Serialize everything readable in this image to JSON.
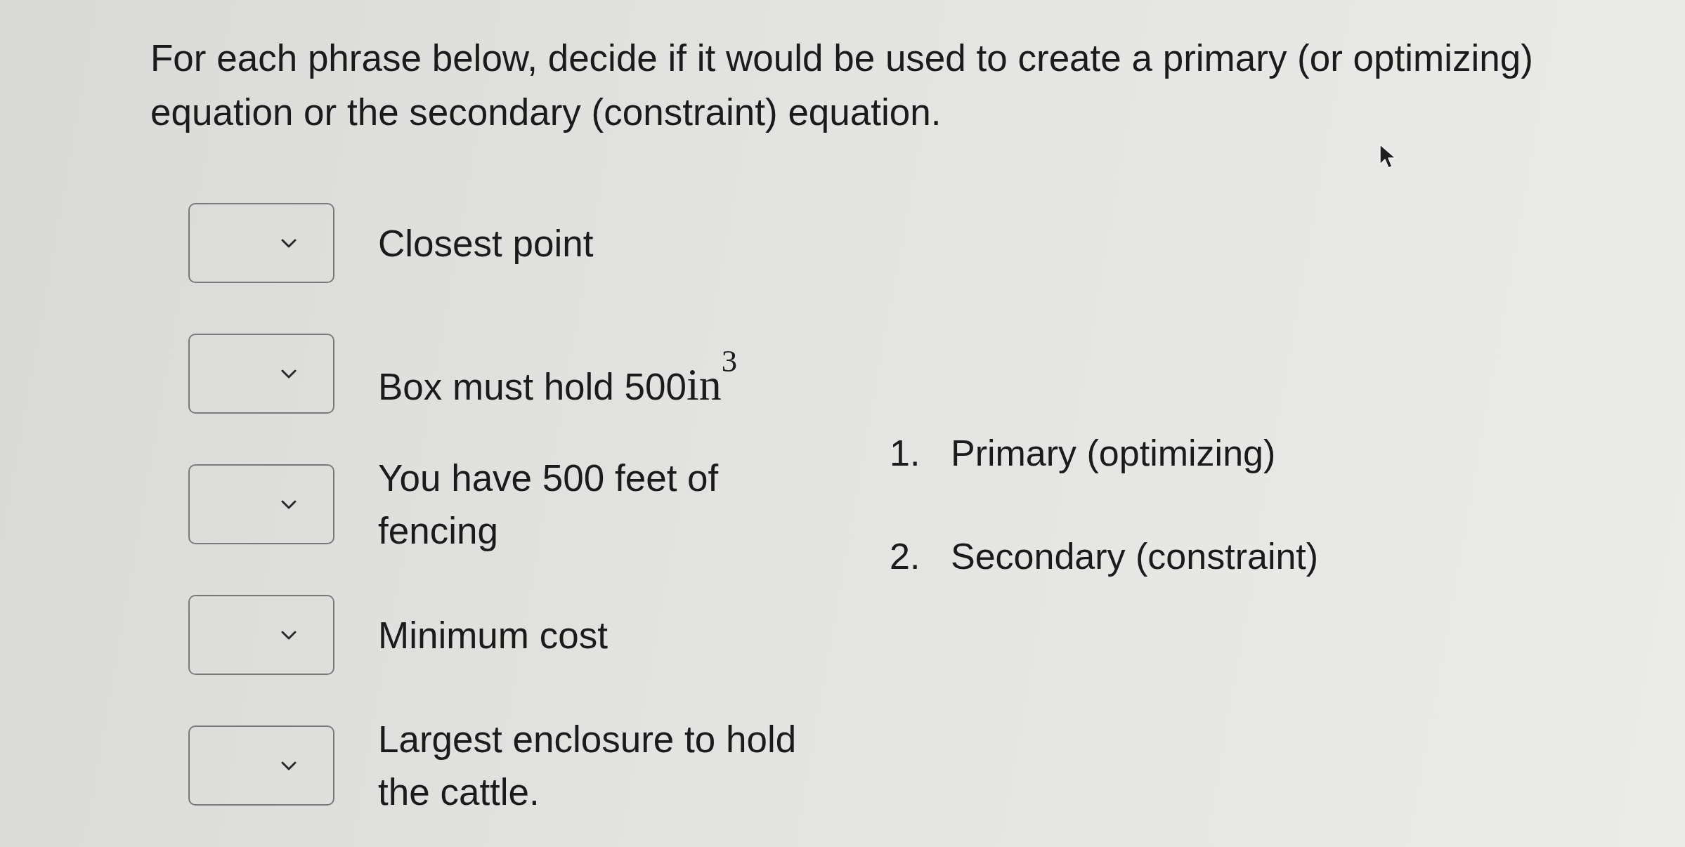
{
  "question": {
    "prompt": "For each phrase below, decide if it would be used to create a primary (or optimizing) equation or the secondary (constraint) equation."
  },
  "items": [
    {
      "phrase": "Closest point"
    },
    {
      "phrase": "Box must hold 500",
      "math": "in$^{3}$"
    },
    {
      "phrase": "You have 500 feet of fencing"
    },
    {
      "phrase": "Minimum cost"
    },
    {
      "phrase": "Largest enclosure to hold the cattle."
    }
  ],
  "options": [
    {
      "number": "1.",
      "label": "Primary (optimizing)"
    },
    {
      "number": "2.",
      "label": "Secondary (constraint)"
    }
  ]
}
